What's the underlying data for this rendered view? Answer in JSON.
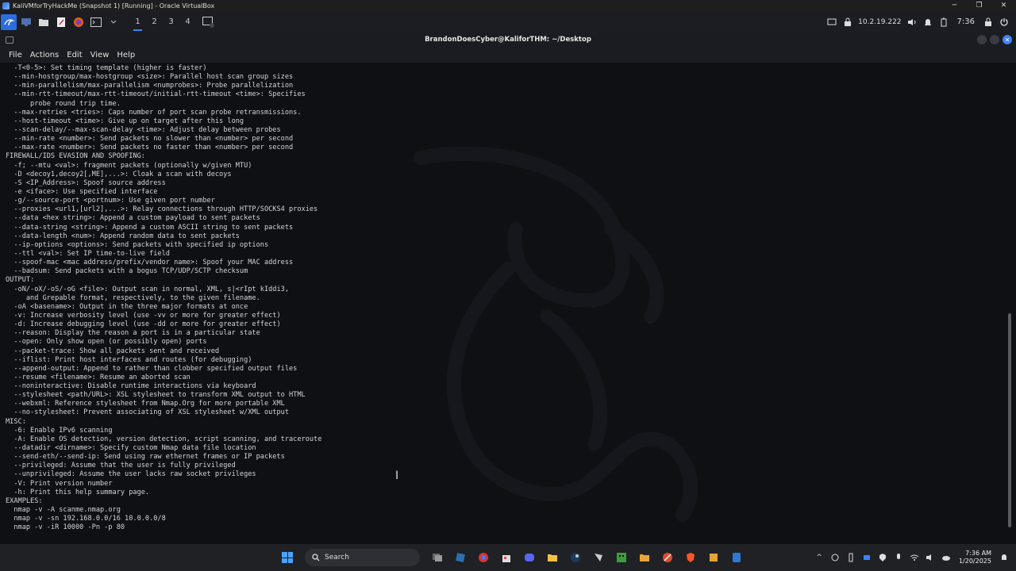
{
  "vbox": {
    "title": "KaliVMforTryHackMe (Snapshot 1) [Running] - Oracle VirtualBox",
    "minimize": "─",
    "restore": "❐",
    "close": "✕"
  },
  "kali_panel": {
    "workspaces": [
      "1",
      "2",
      "3",
      "4"
    ],
    "active_workspace": "1",
    "ip": "10.2.19.222",
    "clock": "7:36"
  },
  "terminal": {
    "title": "BrandonDoesCyber@KaliforTHM: ~/Desktop",
    "menu": [
      "File",
      "Actions",
      "Edit",
      "View",
      "Help"
    ],
    "lines": [
      "  -T<0-5>: Set timing template (higher is faster)",
      "  --min-hostgroup/max-hostgroup <size>: Parallel host scan group sizes",
      "  --min-parallelism/max-parallelism <numprobes>: Probe parallelization",
      "  --min-rtt-timeout/max-rtt-timeout/initial-rtt-timeout <time>: Specifies",
      "      probe round trip time.",
      "  --max-retries <tries>: Caps number of port scan probe retransmissions.",
      "  --host-timeout <time>: Give up on target after this long",
      "  --scan-delay/--max-scan-delay <time>: Adjust delay between probes",
      "  --min-rate <number>: Send packets no slower than <number> per second",
      "  --max-rate <number>: Send packets no faster than <number> per second",
      "FIREWALL/IDS EVASION AND SPOOFING:",
      "  -f; --mtu <val>: fragment packets (optionally w/given MTU)",
      "  -D <decoy1,decoy2[,ME],...>: Cloak a scan with decoys",
      "  -S <IP_Address>: Spoof source address",
      "  -e <iface>: Use specified interface",
      "  -g/--source-port <portnum>: Use given port number",
      "  --proxies <url1,[url2],...>: Relay connections through HTTP/SOCKS4 proxies",
      "  --data <hex string>: Append a custom payload to sent packets",
      "  --data-string <string>: Append a custom ASCII string to sent packets",
      "  --data-length <num>: Append random data to sent packets",
      "  --ip-options <options>: Send packets with specified ip options",
      "  --ttl <val>: Set IP time-to-live field",
      "  --spoof-mac <mac address/prefix/vendor name>: Spoof your MAC address",
      "  --badsum: Send packets with a bogus TCP/UDP/SCTP checksum",
      "OUTPUT:",
      "  -oN/-oX/-oS/-oG <file>: Output scan in normal, XML, s|<rIpt kIddi3,",
      "     and Grepable format, respectively, to the given filename.",
      "  -oA <basename>: Output in the three major formats at once",
      "  -v: Increase verbosity level (use -vv or more for greater effect)",
      "  -d: Increase debugging level (use -dd or more for greater effect)",
      "  --reason: Display the reason a port is in a particular state",
      "  --open: Only show open (or possibly open) ports",
      "  --packet-trace: Show all packets sent and received",
      "  --iflist: Print host interfaces and routes (for debugging)",
      "  --append-output: Append to rather than clobber specified output files",
      "  --resume <filename>: Resume an aborted scan",
      "  --noninteractive: Disable runtime interactions via keyboard",
      "  --stylesheet <path/URL>: XSL stylesheet to transform XML output to HTML",
      "  --webxml: Reference stylesheet from Nmap.Org for more portable XML",
      "  --no-stylesheet: Prevent associating of XSL stylesheet w/XML output",
      "MISC:",
      "  -6: Enable IPv6 scanning",
      "  -A: Enable OS detection, version detection, script scanning, and traceroute",
      "  --datadir <dirname>: Specify custom Nmap data file location",
      "  --send-eth/--send-ip: Send using raw ethernet frames or IP packets",
      "  --privileged: Assume that the user is fully privileged",
      "  --unprivileged: Assume the user lacks raw socket privileges",
      "  -V: Print version number",
      "  -h: Print this help summary page.",
      "EXAMPLES:",
      "  nmap -v -A scanme.nmap.org",
      "  nmap -v -sn 192.168.0.0/16 10.0.0.0/8",
      "  nmap -v -iR 10000 -Pn -p 80"
    ]
  },
  "taskbar": {
    "search_label": "Search",
    "time": "7:36 AM",
    "date": "1/20/2025"
  }
}
